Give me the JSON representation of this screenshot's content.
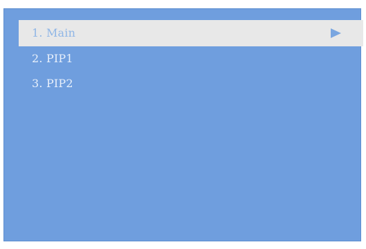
{
  "menu": {
    "items": [
      {
        "label": "1. Main",
        "selected": true
      },
      {
        "label": "2. PIP1",
        "selected": false
      },
      {
        "label": "3. PIP2",
        "selected": false
      }
    ],
    "selected_indicator_icon": "play-arrow-icon"
  },
  "colors": {
    "background": "#6f9ede",
    "selected_row": "#e8e8e8",
    "selected_text": "#8fb6e6",
    "item_text": "#e8f0fb"
  }
}
